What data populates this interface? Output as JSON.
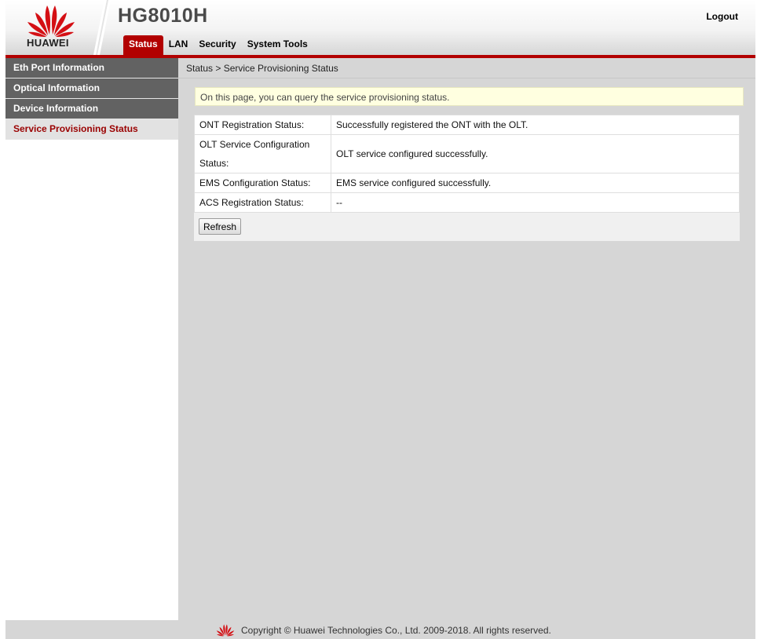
{
  "header": {
    "logo_text": "HUAWEI",
    "model": "HG8010H",
    "logout_label": "Logout",
    "tabs": [
      {
        "label": "Status",
        "active": true
      },
      {
        "label": "LAN",
        "active": false
      },
      {
        "label": "Security",
        "active": false
      },
      {
        "label": "System Tools",
        "active": false
      }
    ]
  },
  "sidebar": {
    "items": [
      {
        "label": "Eth Port Information",
        "active": false
      },
      {
        "label": "Optical Information",
        "active": false
      },
      {
        "label": "Device Information",
        "active": false
      },
      {
        "label": "Service Provisioning Status",
        "active": true
      }
    ]
  },
  "main": {
    "breadcrumb": "Status > Service Provisioning Status",
    "info": "On this page, you can query the service provisioning status.",
    "rows": [
      {
        "label": "ONT Registration Status:",
        "value": "Successfully registered the ONT with the OLT."
      },
      {
        "label_line1": "OLT Service Configuration",
        "label_line2": "Status:",
        "value": "OLT service configured successfully."
      },
      {
        "label": "EMS Configuration Status:",
        "value": "EMS service configured successfully."
      },
      {
        "label": "ACS Registration Status:",
        "value": "--"
      }
    ],
    "refresh_label": "Refresh"
  },
  "footer": {
    "copyright": "Copyright © Huawei Technologies Co., Ltd. 2009-2018. All rights reserved."
  },
  "colors": {
    "brand_red": "#b20000",
    "sidebar_dark": "#626262",
    "main_bg": "#d6d6d6",
    "info_bg": "#ffffe0"
  }
}
